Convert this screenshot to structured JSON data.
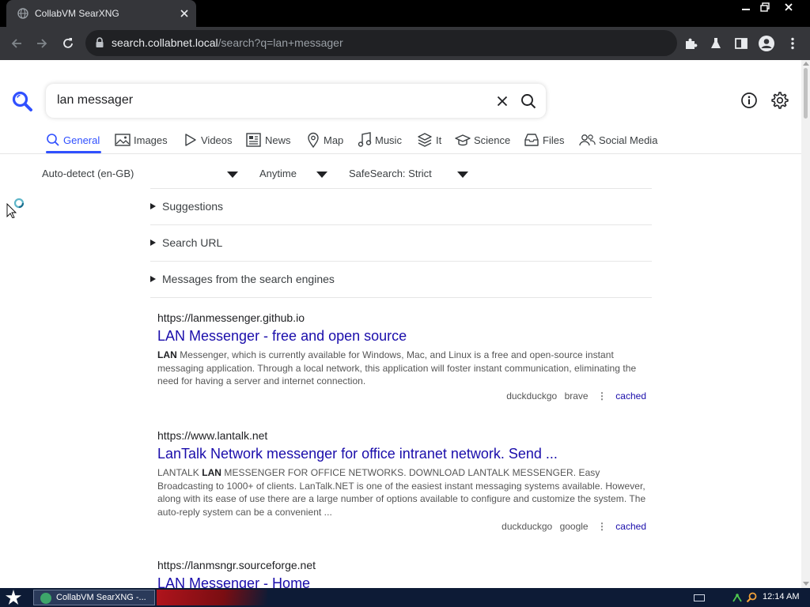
{
  "browser": {
    "tab_title": "CollabVM SearXNG",
    "url_host": "search.collabnet.local",
    "url_path": "/search?q=lan+messager"
  },
  "search": {
    "query": "lan messager",
    "categories": [
      {
        "label": "General",
        "icon": "search-icon",
        "active": true
      },
      {
        "label": "Images",
        "icon": "image-icon"
      },
      {
        "label": "Videos",
        "icon": "play-icon"
      },
      {
        "label": "News",
        "icon": "newspaper-icon"
      },
      {
        "label": "Map",
        "icon": "map-pin-icon"
      },
      {
        "label": "Music",
        "icon": "music-note-icon"
      },
      {
        "label": "It",
        "icon": "layers-icon"
      },
      {
        "label": "Science",
        "icon": "graduation-cap-icon"
      },
      {
        "label": "Files",
        "icon": "inbox-icon"
      },
      {
        "label": "Social Media",
        "icon": "people-icon"
      }
    ],
    "filters": {
      "language": "Auto-detect (en-GB)",
      "time": "Anytime",
      "safesearch": "SafeSearch: Strict"
    },
    "details": [
      "Suggestions",
      "Search URL",
      "Messages from the search engines"
    ]
  },
  "results": [
    {
      "url": "https://lanmessenger.github.io",
      "title": "LAN Messenger - free and open source",
      "snippet_bold": "LAN",
      "snippet_rest": " Messenger, which is currently available for Windows, Mac, and Linux is a free and open-source instant messaging application. Through a local network, this application will foster instant communication, eliminating the need for having a server and internet connection.",
      "engines": [
        "duckduckgo",
        "brave"
      ],
      "cached_label": "cached"
    },
    {
      "url": "https://www.lantalk.net",
      "title": "LanTalk Network messenger for office intranet network. Send ...",
      "snippet_pre": "LANTALK ",
      "snippet_bold": "LAN",
      "snippet_rest": " MESSENGER FOR OFFICE NETWORKS. DOWNLOAD LANTALK MESSENGER. Easy Broadcasting to 1000+ of clients. LanTalk.NET is one of the easiest instant messaging systems available. However, along with its ease of use there are a large number of options available to configure and customize the system. The auto-reply system can be a convenient ...",
      "engines": [
        "duckduckgo",
        "google"
      ],
      "cached_label": "cached"
    },
    {
      "url": "https://lanmsngr.sourceforge.net",
      "title": "LAN Messenger - Home"
    }
  ],
  "taskbar": {
    "task_label": "CollabVM SearXNG -...",
    "clock": "12:14 AM"
  },
  "colors": {
    "accent": "#3050ff",
    "link": "#1a0dab"
  }
}
